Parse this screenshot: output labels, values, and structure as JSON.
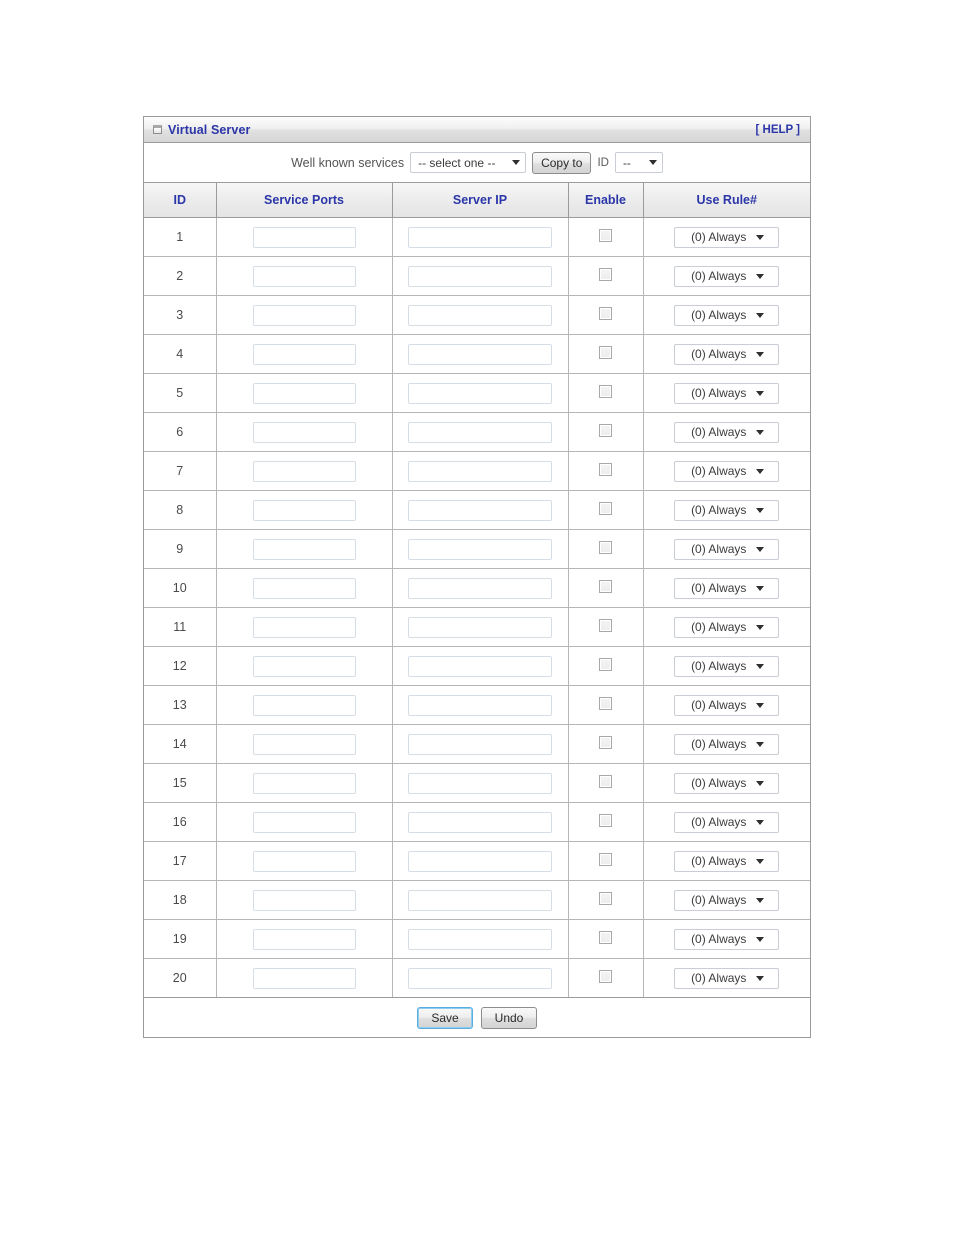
{
  "panel": {
    "title": "Virtual Server",
    "help_label": "[ HELP ]",
    "icon": "window-icon"
  },
  "toolbar": {
    "well_known_label": "Well known services",
    "service_select": {
      "value": "-- select one --",
      "options": [
        "-- select one --"
      ]
    },
    "copy_to_label": "Copy to",
    "id_label": "ID",
    "id_select": {
      "value": "--",
      "options": [
        "--"
      ]
    }
  },
  "table": {
    "headers": [
      "ID",
      "Service Ports",
      "Server IP",
      "Enable",
      "Use Rule#"
    ],
    "rule_default": "(0) Always",
    "rows": [
      {
        "id": "1",
        "service_ports": "",
        "server_ip": "",
        "enable": false,
        "rule": "(0) Always"
      },
      {
        "id": "2",
        "service_ports": "",
        "server_ip": "",
        "enable": false,
        "rule": "(0) Always"
      },
      {
        "id": "3",
        "service_ports": "",
        "server_ip": "",
        "enable": false,
        "rule": "(0) Always"
      },
      {
        "id": "4",
        "service_ports": "",
        "server_ip": "",
        "enable": false,
        "rule": "(0) Always"
      },
      {
        "id": "5",
        "service_ports": "",
        "server_ip": "",
        "enable": false,
        "rule": "(0) Always"
      },
      {
        "id": "6",
        "service_ports": "",
        "server_ip": "",
        "enable": false,
        "rule": "(0) Always"
      },
      {
        "id": "7",
        "service_ports": "",
        "server_ip": "",
        "enable": false,
        "rule": "(0) Always"
      },
      {
        "id": "8",
        "service_ports": "",
        "server_ip": "",
        "enable": false,
        "rule": "(0) Always"
      },
      {
        "id": "9",
        "service_ports": "",
        "server_ip": "",
        "enable": false,
        "rule": "(0) Always"
      },
      {
        "id": "10",
        "service_ports": "",
        "server_ip": "",
        "enable": false,
        "rule": "(0) Always"
      },
      {
        "id": "11",
        "service_ports": "",
        "server_ip": "",
        "enable": false,
        "rule": "(0) Always"
      },
      {
        "id": "12",
        "service_ports": "",
        "server_ip": "",
        "enable": false,
        "rule": "(0) Always"
      },
      {
        "id": "13",
        "service_ports": "",
        "server_ip": "",
        "enable": false,
        "rule": "(0) Always"
      },
      {
        "id": "14",
        "service_ports": "",
        "server_ip": "",
        "enable": false,
        "rule": "(0) Always"
      },
      {
        "id": "15",
        "service_ports": "",
        "server_ip": "",
        "enable": false,
        "rule": "(0) Always"
      },
      {
        "id": "16",
        "service_ports": "",
        "server_ip": "",
        "enable": false,
        "rule": "(0) Always"
      },
      {
        "id": "17",
        "service_ports": "",
        "server_ip": "",
        "enable": false,
        "rule": "(0) Always"
      },
      {
        "id": "18",
        "service_ports": "",
        "server_ip": "",
        "enable": false,
        "rule": "(0) Always"
      },
      {
        "id": "19",
        "service_ports": "",
        "server_ip": "",
        "enable": false,
        "rule": "(0) Always"
      },
      {
        "id": "20",
        "service_ports": "",
        "server_ip": "",
        "enable": false,
        "rule": "(0) Always"
      }
    ]
  },
  "footer": {
    "save_label": "Save",
    "undo_label": "Undo"
  },
  "colors": {
    "heading_blue": "#2b36a8",
    "panel_border": "#9b9b9b",
    "focus_blue": "#5aaee0"
  }
}
